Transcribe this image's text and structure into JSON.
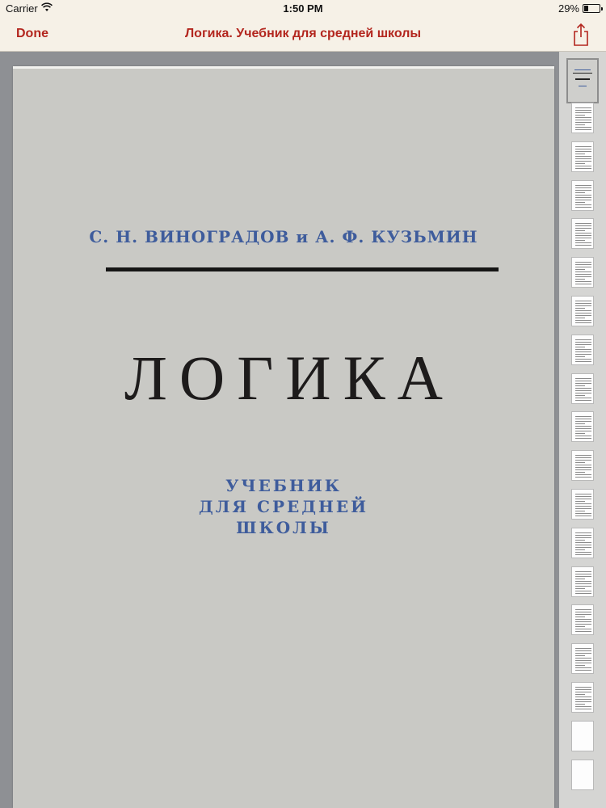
{
  "status_bar": {
    "carrier": "Carrier",
    "time": "1:50 PM",
    "battery_percent": "29%",
    "battery_level": 0.29
  },
  "nav_bar": {
    "done_label": "Done",
    "title": "Логика. Учебник для средней школы",
    "share_icon": "share-icon"
  },
  "accent_color": "#b3261e",
  "page": {
    "authors": "С. Н. ВИНОГРАДОВ и А. Ф. КУЗЬМИН",
    "title": "ЛОГИКА",
    "subtitle_lines": [
      "УЧЕБНИК",
      "ДЛЯ СРЕДНЕЙ",
      "ШКОЛЫ"
    ]
  },
  "thumbnails": {
    "count": 19,
    "selected_index": 0
  }
}
